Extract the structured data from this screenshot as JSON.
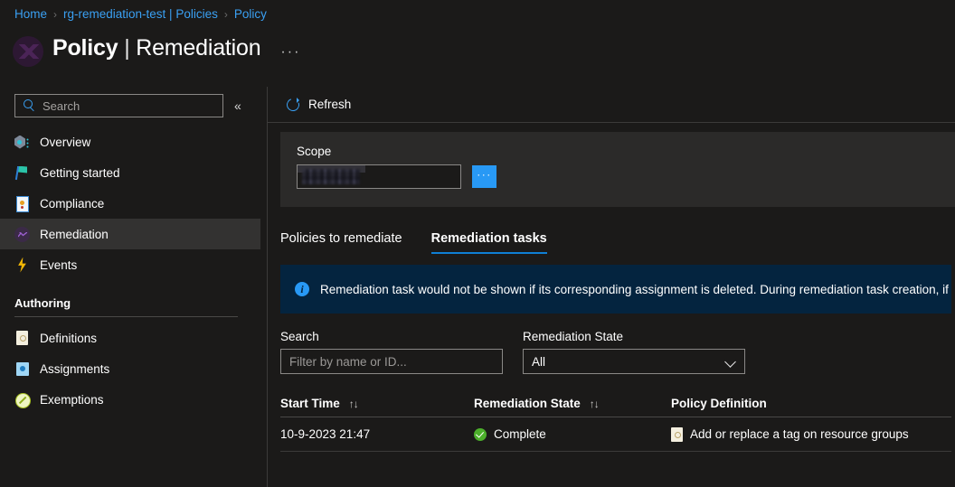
{
  "breadcrumb": {
    "items": [
      {
        "label": "Home"
      },
      {
        "label": "rg-remediation-test | Policies"
      },
      {
        "label": "Policy"
      }
    ],
    "separator": "›"
  },
  "header": {
    "title_main": "Policy",
    "title_sep": "|",
    "title_sub": "Remediation",
    "more_menu": "···"
  },
  "sidebar": {
    "search": {
      "placeholder": "Search",
      "value": ""
    },
    "collapse_label": "«",
    "items": [
      {
        "label": "Overview",
        "icon": "overview-icon",
        "selected": false
      },
      {
        "label": "Getting started",
        "icon": "flag-icon",
        "selected": false
      },
      {
        "label": "Compliance",
        "icon": "compliance-doc-icon",
        "selected": false
      },
      {
        "label": "Remediation",
        "icon": "remediation-icon",
        "selected": true
      },
      {
        "label": "Events",
        "icon": "lightning-bolt-icon",
        "selected": false
      }
    ],
    "section": {
      "title": "Authoring",
      "items": [
        {
          "label": "Definitions",
          "icon": "definition-doc-icon"
        },
        {
          "label": "Assignments",
          "icon": "assignment-icon"
        },
        {
          "label": "Exemptions",
          "icon": "exemption-icon"
        }
      ]
    }
  },
  "command_bar": {
    "refresh_label": "Refresh"
  },
  "scope": {
    "label": "Scope",
    "value": "",
    "redacted": true,
    "browse_label": "···"
  },
  "tabs": [
    {
      "label": "Policies to remediate",
      "active": false
    },
    {
      "label": "Remediation tasks",
      "active": true
    }
  ],
  "banner": {
    "icon": "info-icon",
    "text": "Remediation task would not be shown if its corresponding assignment is deleted. During remediation task creation, if a"
  },
  "filters": {
    "search": {
      "label": "Search",
      "placeholder": "Filter by name or ID...",
      "value": ""
    },
    "state": {
      "label": "Remediation State",
      "selected": "All",
      "options": [
        "All"
      ]
    }
  },
  "table": {
    "columns": [
      {
        "label": "Start Time",
        "sortable": true,
        "sort_glyph": "↑↓"
      },
      {
        "label": "Remediation State",
        "sortable": true,
        "sort_glyph": "↑↓"
      },
      {
        "label": "Policy Definition",
        "sortable": false,
        "sort_glyph": ""
      }
    ],
    "rows": [
      {
        "start_time": "10-9-2023 21:47",
        "state": "Complete",
        "state_icon": "success-check-icon",
        "definition": "Add or replace a tag on resource groups",
        "definition_icon": "definition-doc-icon"
      }
    ]
  },
  "colors": {
    "page_bg": "#1b1a19",
    "card_bg": "#2b2a29",
    "link": "#3aa0f3",
    "accent": "#0f7fd4",
    "banner_bg": "#04243f",
    "success": "#4caf2b",
    "selected_nav": "#333231",
    "primary_button": "#2899f5"
  }
}
